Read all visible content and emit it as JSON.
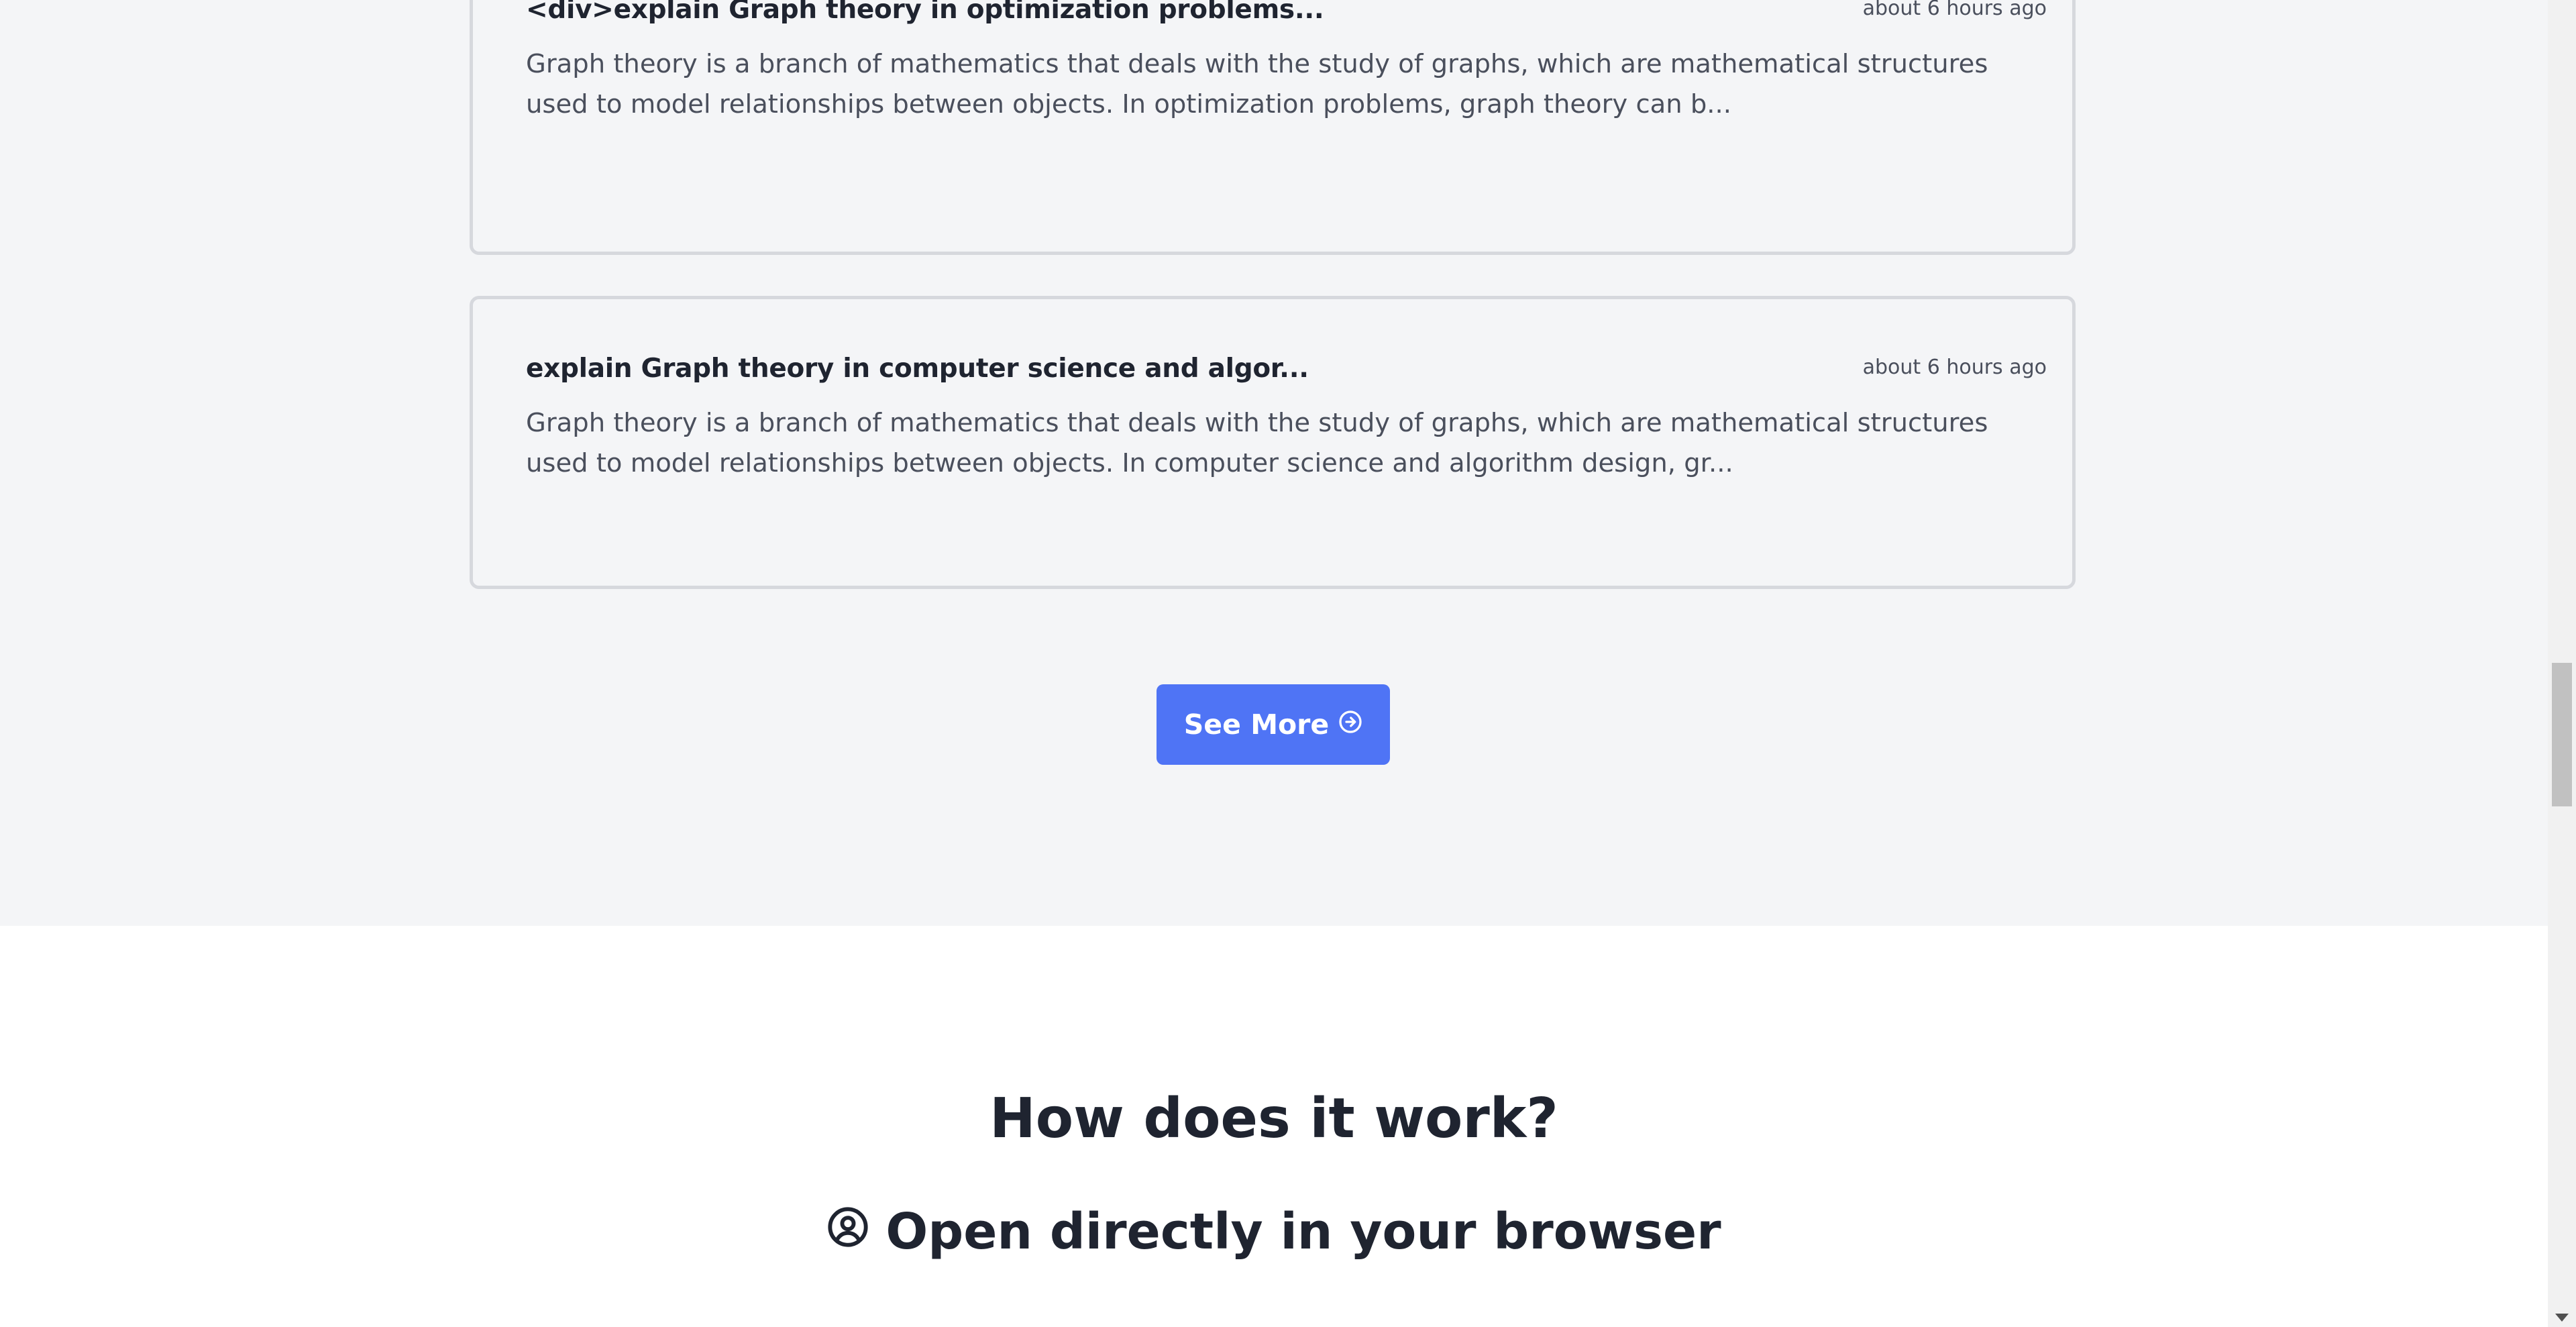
{
  "history_cards": [
    {
      "title": "<div>explain Graph theory in optimization problems...",
      "time": "about 6 hours ago",
      "excerpt": "Graph theory is a branch of mathematics that deals with the study of graphs, which are mathematical structures used to model relationships between objects. In optimization problems, graph theory can b..."
    },
    {
      "title": "explain Graph theory in computer science and algor...",
      "time": "about 6 hours ago",
      "excerpt": "Graph theory is a branch of mathematics that deals with the study of graphs, which are mathematical structures used to model relationships between objects. In computer science and algorithm design, gr..."
    }
  ],
  "see_more": {
    "label": "See More",
    "icon": "arrow-right-circle-icon"
  },
  "how_it_works": {
    "title": "How does it work?",
    "step_1": {
      "icon": "user-circle-icon",
      "label": "Open directly in your browser"
    }
  },
  "colors": {
    "accent": "#4f74f5",
    "section_bg": "#f4f5f7",
    "text_dark": "#1f2430",
    "text_muted": "#4a4f5c",
    "card_border": "#d6d8dd"
  }
}
